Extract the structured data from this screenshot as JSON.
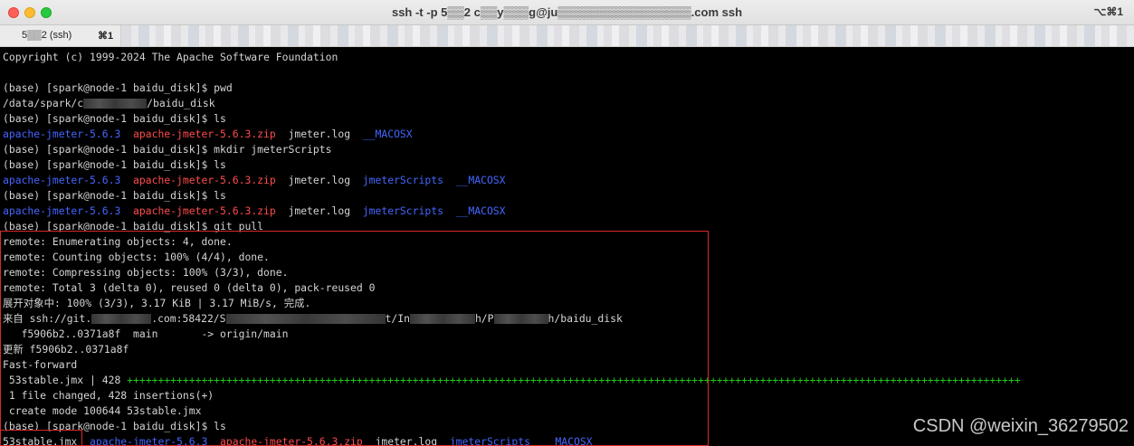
{
  "window": {
    "title": "ssh -t -p 5▒▒2 c▒▒y▒▒▒g@ju▒▒▒▒▒▒▒▒▒▒▒▒▒▒▒▒.com ssh",
    "title_shortcut": "⌥⌘1"
  },
  "tab": {
    "label": "5▒▒2 (ssh)",
    "shortcut": "⌘1"
  },
  "terminal": {
    "copyright": "Copyright (c) 1999-2024 The Apache Software Foundation",
    "cmd_pwd": "(base) [spark@node-1 baidu_disk]$ pwd",
    "pwd_prefix": "/data/spark/c",
    "pwd_suffix": "/baidu_disk",
    "cmd_ls1": "(base) [spark@node-1 baidu_disk]$ ls",
    "ls1": {
      "d1": "apache-jmeter-5.6.3",
      "z1": "apache-jmeter-5.6.3.zip",
      "f1": "jmeter.log",
      "d2": "__MACOSX"
    },
    "cmd_mkdir": "(base) [spark@node-1 baidu_disk]$ mkdir jmeterScripts",
    "cmd_ls2": "(base) [spark@node-1 baidu_disk]$ ls",
    "ls2": {
      "d1": "apache-jmeter-5.6.3",
      "z1": "apache-jmeter-5.6.3.zip",
      "f1": "jmeter.log",
      "d2": "jmeterScripts",
      "d3": "__MACOSX"
    },
    "cmd_ls3": "(base) [spark@node-1 baidu_disk]$ ls",
    "ls3": {
      "d1": "apache-jmeter-5.6.3",
      "z1": "apache-jmeter-5.6.3.zip",
      "f1": "jmeter.log",
      "d2": "jmeterScripts",
      "d3": "__MACOSX"
    },
    "cmd_pull": "(base) [spark@node-1 baidu_disk]$ git pull",
    "remote1": "remote: Enumerating objects: 4, done.",
    "remote2": "remote: Counting objects: 100% (4/4), done.",
    "remote3": "remote: Compressing objects: 100% (3/3), done.",
    "remote4": "remote: Total 3 (delta 0), reused 0 (delta 0), pack-reused 0",
    "unpack": "展开对象中: 100% (3/3), 3.17 KiB | 3.17 MiB/s, 完成.",
    "from_a": "来自 ssh://git.",
    "from_b": ".com:58422/S",
    "from_c": "t/In",
    "from_d": "h/P",
    "from_e": "h/baidu_disk",
    "branch": "   f5906b2..0371a8f  main       -> origin/main",
    "update": "更新 f5906b2..0371a8f",
    "fastforward": "Fast-forward",
    "stat_file": " 53stable.jmx | 428 ",
    "stat_plus": "++++++++++++++++++++++++++++++++++++++++++++++++++++++++++++++++++++++++++++++++++++++++++++++++++++++++++++++++++++++++++++++++++++++++++++++++",
    "summary": " 1 file changed, 428 insertions(+)",
    "create": " create mode 100644 53stable.jmx",
    "cmd_ls4": "(base) [spark@node-1 baidu_disk]$ ls",
    "ls4": {
      "f0": "53stable.jmx",
      "d1": "apache-jmeter-5.6.3",
      "z1": "apache-jmeter-5.6.3.zip",
      "f1": "jmeter.log",
      "d2": "jmeterScripts",
      "d3": "__MACOSX"
    }
  },
  "watermark": "CSDN @weixin_36279502",
  "colors": {
    "directory": "#4466ff",
    "archive": "#ff4b4b",
    "diffstat_plus": "#22c61c",
    "highlight_box": "#d62a2a"
  }
}
